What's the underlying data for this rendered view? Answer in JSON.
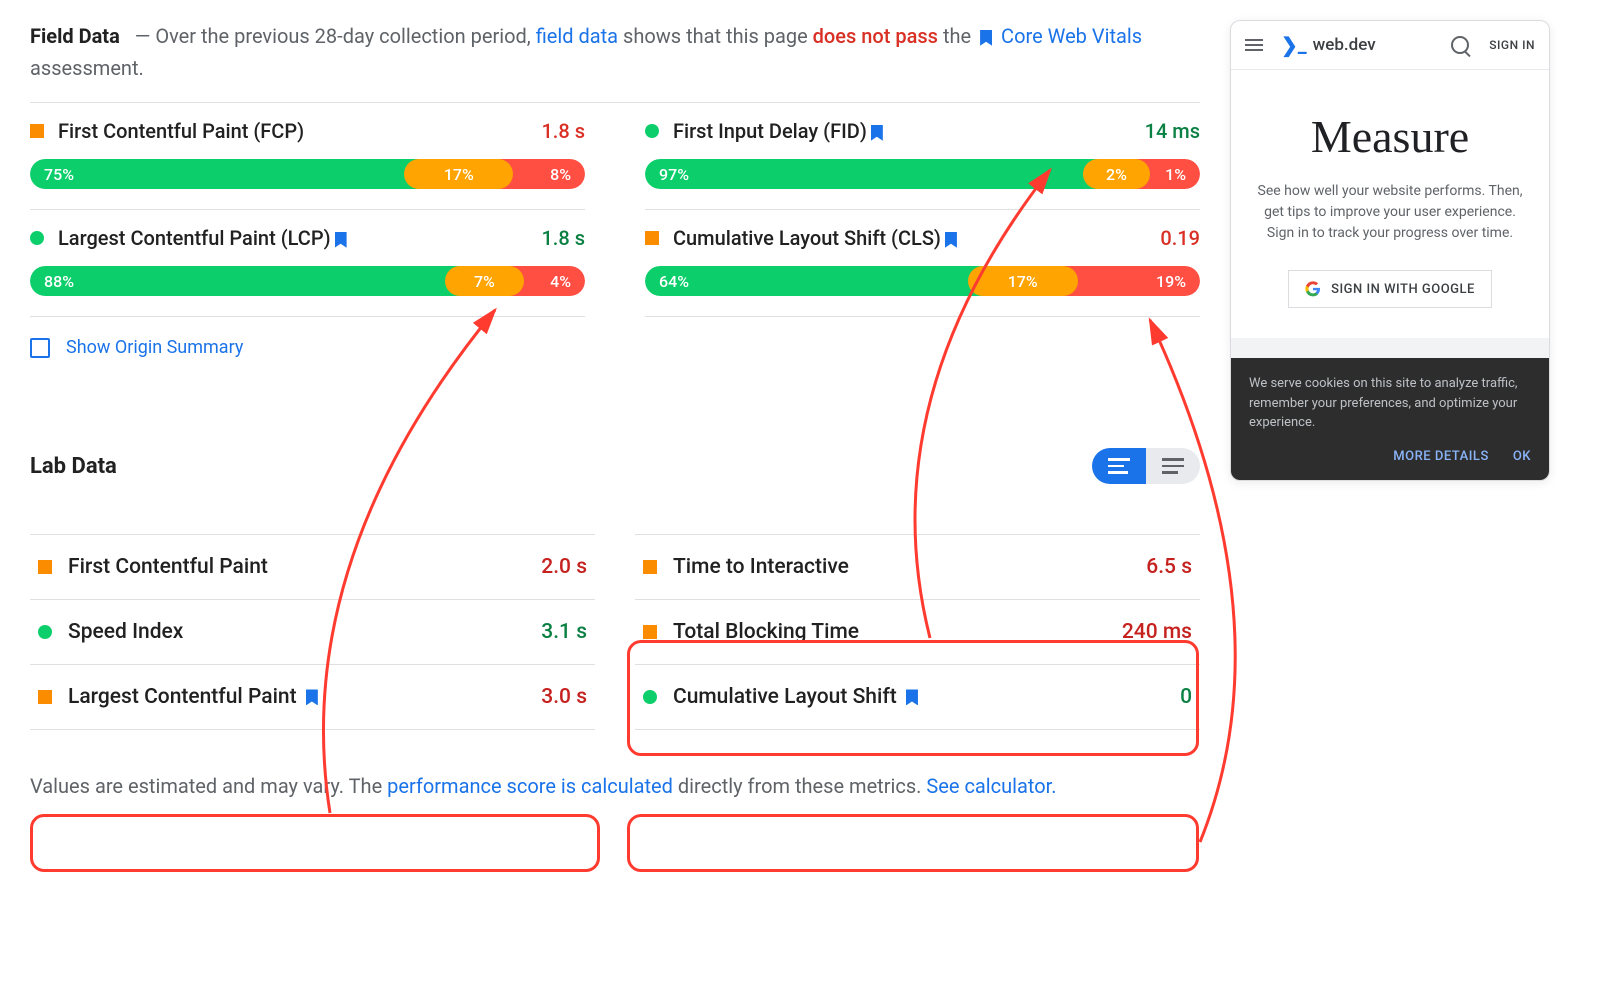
{
  "header": {
    "title": "Field Data",
    "sep": "—",
    "txt1": "Over the previous 28-day collection period,",
    "link1": "field data",
    "txt2": "shows that this page",
    "fail": "does not pass",
    "txt3": "the",
    "link2": "Core Web Vitals",
    "txt4": "assessment."
  },
  "field_metrics": [
    {
      "name": "First Contentful Paint (FCP)",
      "value": "1.8 s",
      "dot": "orange",
      "valClass": "val-orange",
      "g": "75%",
      "o": "17%",
      "r": "8%",
      "gw": 73,
      "ow": 18,
      "rw": 12,
      "bookmark": false
    },
    {
      "name": "First Input Delay (FID)",
      "value": "14 ms",
      "dot": "green",
      "valClass": "val-green",
      "g": "97%",
      "o": "2%",
      "r": "1%",
      "gw": 90,
      "ow": 10,
      "rw": 8,
      "bookmark": true
    },
    {
      "name": "Largest Contentful Paint (LCP)",
      "value": "1.8 s",
      "dot": "green",
      "valClass": "val-green",
      "g": "88%",
      "o": "7%",
      "r": "4%",
      "gw": 82,
      "ow": 12,
      "rw": 10,
      "bookmark": true
    },
    {
      "name": "Cumulative Layout Shift (CLS)",
      "value": "0.19",
      "dot": "orange",
      "valClass": "val-orange",
      "g": "64%",
      "o": "17%",
      "r": "19%",
      "gw": 62,
      "ow": 18,
      "rw": 22,
      "bookmark": true
    }
  ],
  "origin": {
    "label": "Show Origin Summary"
  },
  "lab": {
    "title": "Lab Data",
    "metrics": [
      {
        "name": "First Contentful Paint",
        "value": "2.0 s",
        "dot": "orange",
        "valClass": "val-orange2",
        "bookmark": false
      },
      {
        "name": "Time to Interactive",
        "value": "6.5 s",
        "dot": "orange",
        "valClass": "val-orange2",
        "bookmark": false
      },
      {
        "name": "Speed Index",
        "value": "3.1 s",
        "dot": "green",
        "valClass": "val-green",
        "bookmark": false
      },
      {
        "name": "Total Blocking Time",
        "value": "240 ms",
        "dot": "orange",
        "valClass": "val-orange2",
        "bookmark": false
      },
      {
        "name": "Largest Contentful Paint",
        "value": "3.0 s",
        "dot": "orange",
        "valClass": "val-orange2",
        "bookmark": true
      },
      {
        "name": "Cumulative Layout Shift",
        "value": "0",
        "dot": "green",
        "valClass": "val-green",
        "bookmark": true
      }
    ]
  },
  "footer": {
    "txt1": "Values are estimated and may vary. The",
    "link1": "performance score is calculated",
    "txt2": "directly from these metrics.",
    "link2": "See calculator."
  },
  "device": {
    "brand": "web.dev",
    "signin": "SIGN IN",
    "h1": "Measure",
    "desc": "See how well your website performs. Then, get tips to improve your user experience. Sign in to track your progress over time.",
    "gbtn": "SIGN IN WITH GOOGLE",
    "cookie": "We serve cookies on this site to analyze traffic, remember your preferences, and optimize your experience.",
    "more": "MORE DETAILS",
    "ok": "OK"
  }
}
